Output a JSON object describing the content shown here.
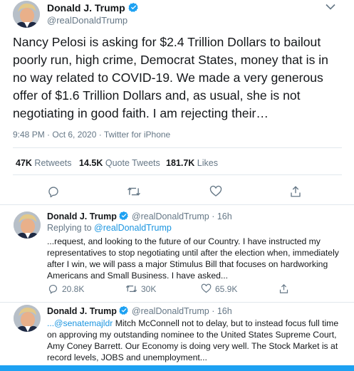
{
  "main_tweet": {
    "display_name": "Donald J. Trump",
    "handle": "@realDonaldTrump",
    "text": "Nancy Pelosi is asking for $2.4 Trillion Dollars to bailout poorly run, high crime, Democrat States, money that is in no way related to COVID-19. We made a very generous offer of $1.6 Trillion Dollars and, as usual, she is not negotiating in good faith. I am rejecting their…",
    "timestamp": "9:48 PM · Oct 6, 2020 · Twitter for iPhone",
    "stats": {
      "retweets_count": "47K",
      "retweets_label": "Retweets",
      "quotes_count": "14.5K",
      "quotes_label": "Quote Tweets",
      "likes_count": "181.7K",
      "likes_label": "Likes"
    }
  },
  "reply_1": {
    "display_name": "Donald J. Trump",
    "handle": "@realDonaldTrump",
    "separator": "·",
    "time": "16h",
    "replying_prefix": "Replying to",
    "replying_to": "@realDonaldTrump",
    "text": "...request, and looking to the future of our Country. I have instructed my representatives to stop negotiating until after the election when, immediately after I win, we will pass a major Stimulus Bill that focuses on hardworking Americans and Small Business. I have asked...",
    "replies": "20.8K",
    "retweets": "30K",
    "likes": "65.9K"
  },
  "reply_2": {
    "display_name": "Donald J. Trump",
    "handle": "@realDonaldTrump",
    "separator": "·",
    "time": "16h",
    "mention": "...@senatemajldr",
    "text": " Mitch McConnell not to delay, but to instead focus full time on approving my outstanding nominee to the United States Supreme Court, Amy Coney Barrett. Our Economy is doing very well. The Stock Market is at record levels, JOBS and unemployment..."
  },
  "colors": {
    "accent": "#1da1f2",
    "link": "#1b95e0",
    "text": "#14171a",
    "muted": "#657786",
    "divider": "#e1e8ed"
  }
}
